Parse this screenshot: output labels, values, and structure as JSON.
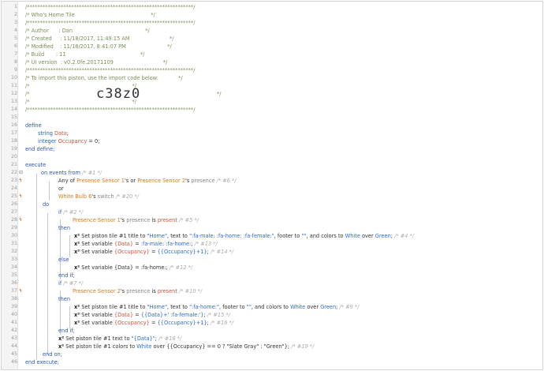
{
  "line_numbers": [
    "1",
    "2",
    "3",
    "4",
    "5",
    "6",
    "7",
    "8",
    "9",
    "10",
    "11",
    "12",
    "13",
    "14",
    "15",
    "16",
    "17",
    "18",
    "19",
    "20",
    "21",
    "22",
    "23",
    "24",
    "25",
    "26",
    "27",
    "28",
    "29",
    "30",
    "31",
    "32",
    "33",
    "34",
    "35",
    "36",
    "37",
    "38",
    "39",
    "40",
    "41",
    "42",
    "43",
    "44",
    "45",
    "46"
  ],
  "header": {
    "border": "/****************************************************************/",
    "title": "/* Who's Home Tile                                              */",
    "author": "/* Author      : Dan                                            */",
    "created": "/* Created     : 11/18/2017, 11:49:15 AM                        */",
    "modified": "/* Modified    : 11/18/2017, 8:41:07 PM                         */",
    "build": "/* Build       : 11                                             */",
    "ui_version": "/* UI version  : v0.2.0fe.20171109                              */",
    "import_note": "/* To import this piston, use the import code below:            */",
    "blank": "/*                                                              */",
    "import_code_left": "/*",
    "import_code": "c38z0",
    "import_code_right": "*/"
  },
  "code": {
    "define": "define",
    "string_type": "string",
    "string_var": "Data",
    "integer_type": "integer",
    "integer_var": "Occupancy",
    "integer_init": " = 0;",
    "end_define": "end define;",
    "execute": "execute",
    "on_events_from": "on events from",
    "c1": "/* #1 */",
    "any_of": "Any of",
    "ps1": "Presence Sensor 1",
    "ps2": "Presence Sensor 2",
    "s_or_txt": "'s or",
    "poss": "'s",
    "presence_word": "presence",
    "c6": "/* #6 */",
    "or": "or",
    "wb6": "White Bulb 6",
    "switch_word": "switch",
    "c20": "/* #20 */",
    "do": "do",
    "if": "if",
    "c2": "/* #2 */",
    "is_txt": "is",
    "present": "present",
    "c5": "/* #5 */",
    "then": "then",
    "x2": "x²",
    "set_tile_1": "Set piston tile #1 title to",
    "home_str": "\"Home\"",
    "text_to": ", text to",
    "home_m_f": "\":fa-male: :fa-home: :fa-female:\"",
    "footer_to": ", footer to",
    "empty_str": "\"\"",
    "and_colors": ", and colors to",
    "white": "White",
    "over": "over",
    "green": "Green",
    "c4": "/* #4 */",
    "set_var": "Set variable",
    "data_var": "{Data}",
    "occ_var": "{Occupancy}",
    "eq": "=",
    "male_home": ":fa-male: :fa-home:",
    "c13": "/* #13 */",
    "occ_expr": "{{Occupancy}+1}",
    "c14": "/* #14 */",
    "else": "else",
    "data_home": "{Data} = :fa-home:;",
    "c12": "/* #12 */",
    "end_if": "end if;",
    "c7": "/* #7 */",
    "c10": "/* #10 */",
    "home_only": "\":fa-home:\"",
    "c9": "/* #9 */",
    "data_plus_female": "{{Data}+' :fa-female:'}",
    "c15": "/* #15 */",
    "c16": "/* #16 */",
    "set_tile_text": "Set piston tile #1 text to",
    "data_quoted": "\"{Data}\"",
    "c18": "/* #18 */",
    "set_tile_colors": "Set piston tile #1 colors to",
    "over_expr": "over {{Occupancy} == 0 ? \"Slate Gray\" : \"Green\"};",
    "c19": "/* #19 */",
    "end_on": "end on;",
    "end_execute": "end execute;"
  }
}
